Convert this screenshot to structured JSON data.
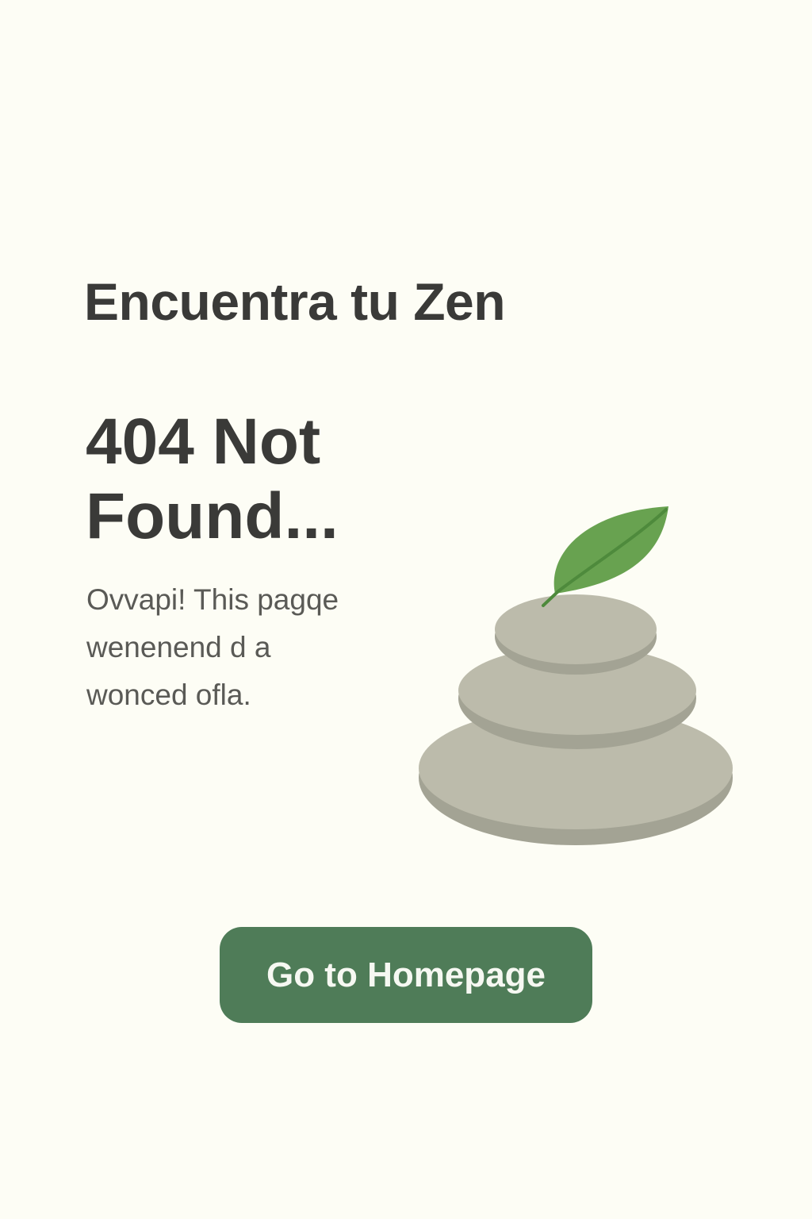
{
  "brand": {
    "title": "Encuentra tu Zen"
  },
  "error": {
    "heading": "404 Not Found...",
    "message": "Ovvapi! This pagqe wenenend d a wonced ofla."
  },
  "actions": {
    "home_label": "Go to Homepage"
  },
  "illustration": {
    "icon": "stacked-stones-with-leaf",
    "stone_color": "#bcbbab",
    "stone_shadow": "#a3a394",
    "leaf_color": "#68a250"
  },
  "colors": {
    "background": "#fdfdf5",
    "text": "#3a3a38",
    "button": "#4f7c58"
  }
}
